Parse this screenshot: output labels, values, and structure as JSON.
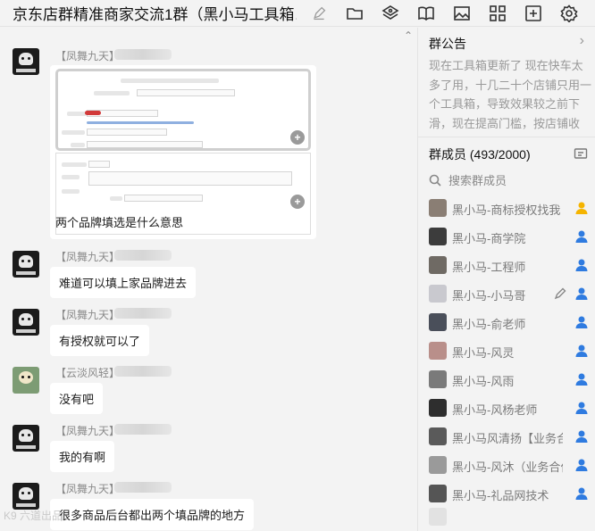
{
  "window": {
    "title": "京东店群精准商家交流1群（黑小马工具箱…",
    "toolbar_icons": [
      "edit-icon",
      "folder-icon",
      "apps-icon",
      "book-icon",
      "image-icon",
      "grid-icon",
      "add-icon",
      "gear-icon"
    ]
  },
  "chat": {
    "messages": [
      {
        "sender": "【凤舞九天】",
        "type": "image",
        "text": "两个品牌填选是什么意思"
      },
      {
        "sender": "【凤舞九天】",
        "type": "text",
        "text": "难道可以填上家品牌进去"
      },
      {
        "sender": "【凤舞九天】",
        "type": "text",
        "text": "有授权就可以了"
      },
      {
        "sender": "【云淡风轻】",
        "type": "text",
        "text": "没有吧"
      },
      {
        "sender": "【凤舞九天】",
        "type": "text",
        "text": "我的有啊"
      },
      {
        "sender": "【凤舞九天】",
        "type": "text",
        "text": "很多商品后台都出两个填品牌的地方"
      }
    ],
    "watermark": "K9 六道出品"
  },
  "sidebar": {
    "notice_title": "群公告",
    "notice_text": "现在工具箱更新了 现在快车太多了用，十几二十个店铺只用一个工具箱，导致效果较之前下滑，现在提高门槛，按店铺收费，",
    "members_title": "群成员 (493/2000)",
    "search_placeholder": "搜索群成员",
    "members": [
      {
        "name": "黑小马-商标授权找我",
        "role": "owner",
        "role_color": "#f5b400"
      },
      {
        "name": "黑小马-商学院",
        "role": "admin",
        "role_color": "#2f7be0"
      },
      {
        "name": "黑小马-工程师",
        "role": "admin",
        "role_color": "#2f7be0"
      },
      {
        "name": "黑小马-小马哥",
        "role": "admin",
        "role_color": "#2f7be0",
        "editable": true
      },
      {
        "name": "黑小马-俞老师",
        "role": "admin",
        "role_color": "#2f7be0"
      },
      {
        "name": "黑小马-风灵",
        "role": "admin",
        "role_color": "#2f7be0"
      },
      {
        "name": "黑小马-风雨",
        "role": "admin",
        "role_color": "#2f7be0"
      },
      {
        "name": "黑小马-风杨老师",
        "role": "admin",
        "role_color": "#2f7be0"
      },
      {
        "name": "黑小马风清扬【业务合作",
        "role": "admin",
        "role_color": "#2f7be0"
      },
      {
        "name": "黑小马-风沐（业务合作",
        "role": "admin",
        "role_color": "#2f7be0"
      },
      {
        "name": "黑小马-礼品网技术",
        "role": "admin",
        "role_color": "#2f7be0"
      }
    ]
  }
}
